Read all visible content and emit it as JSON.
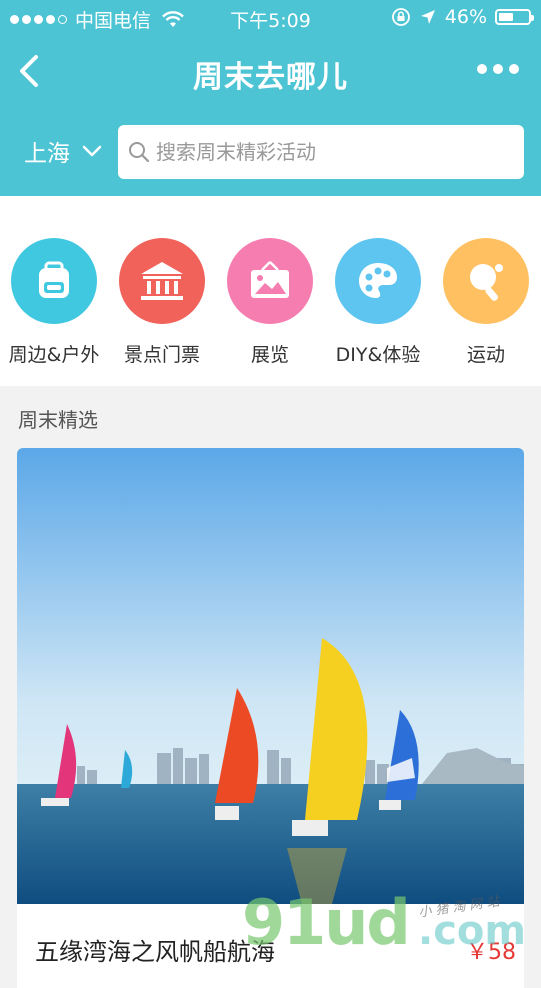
{
  "status": {
    "carrier": "中国电信",
    "time": "下午5:09",
    "battery": "46%",
    "battery_level": 0.46
  },
  "nav": {
    "title": "周末去哪儿"
  },
  "search": {
    "city": "上海",
    "placeholder": "搜索周末精彩活动"
  },
  "categories": [
    {
      "label": "周边&户外",
      "icon": "backpack-icon",
      "color": "#3fc8e0"
    },
    {
      "label": "景点门票",
      "icon": "temple-icon",
      "color": "#f0625a"
    },
    {
      "label": "展览",
      "icon": "picture-icon",
      "color": "#f57db0"
    },
    {
      "label": "DIY&体验",
      "icon": "palette-icon",
      "color": "#5ec4f0"
    },
    {
      "label": "运动",
      "icon": "ping-pong-icon",
      "color": "#ffc062"
    }
  ],
  "section": {
    "title": "周末精选"
  },
  "featured": {
    "name": "五缘湾海之风帆船航海",
    "price": "￥58"
  },
  "watermark": {
    "main": "91ud",
    "domain": ".com",
    "tagline": "小 猪 淘 网 站"
  },
  "colors": {
    "header": "#4dc4d4",
    "price": "#e53935"
  }
}
